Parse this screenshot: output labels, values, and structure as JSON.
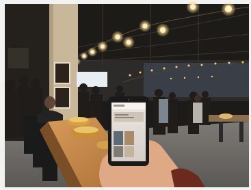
{
  "image": {
    "kind": "photo",
    "scene": "indoor-event-space"
  },
  "colors": {
    "frame": "#f2f2f2",
    "ceiling": "#1c1a17",
    "bulb": "#ffd98a",
    "wall_column": "#c9b79a",
    "floor": "#6d6a66",
    "table": "#c48a4a",
    "phone": "#1a1a1a",
    "hand": "#e0a985"
  }
}
